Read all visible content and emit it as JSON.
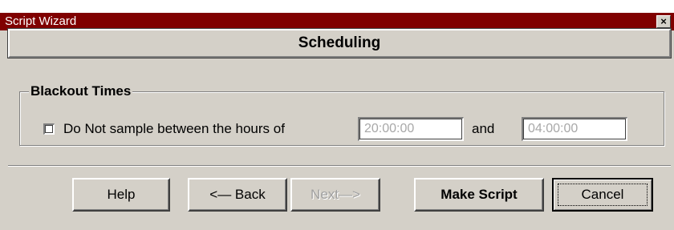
{
  "window": {
    "title": "Script Wizard",
    "close_glyph": "×"
  },
  "header": {
    "title": "Scheduling"
  },
  "blackout": {
    "legend": "Blackout Times",
    "checkbox_checked": false,
    "checkbox_label": "Do Not sample between the hours of",
    "start_time": "20:00:00",
    "and_label": "and",
    "end_time": "04:00:00"
  },
  "buttons": {
    "help": "Help",
    "back": "<— Back",
    "next": "Next—>",
    "make_script": "Make Script",
    "cancel": "Cancel"
  },
  "colors": {
    "titlebar": "#800000",
    "face": "#d4d0c8",
    "disabled_text": "#a8a8a8"
  }
}
